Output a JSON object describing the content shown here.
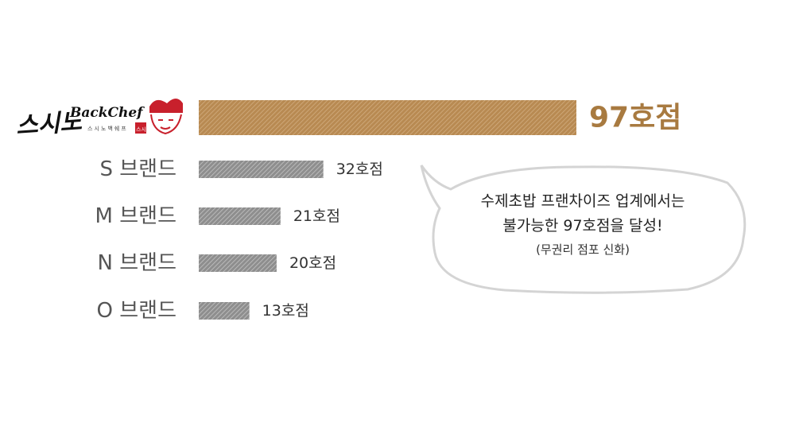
{
  "chart_data": {
    "type": "bar",
    "orientation": "horizontal",
    "categories": [
      "스시노 BackChef",
      "S 브랜드",
      "M 브랜드",
      "N 브랜드",
      "O 브랜드"
    ],
    "values": [
      97,
      32,
      21,
      20,
      13
    ],
    "value_labels": [
      "97호점",
      "32호점",
      "21호점",
      "20호점",
      "13호점"
    ],
    "highlight_index": 0,
    "colors": {
      "highlight": "#b88a52",
      "highlight_stripe": "#d2ad80",
      "other": "#8e8e8e",
      "other_stripe": "#c4c4c4",
      "highlight_label": "#a87a40",
      "label": "#333333"
    }
  },
  "logo": {
    "korean": "스시노",
    "brand": "BackChef",
    "sub": "스시노백쉐프",
    "seal": "스시"
  },
  "bubble": {
    "line1": "수제초밥 프랜차이즈 업계에서는",
    "line2": "불가능한 97호점을 달성!",
    "line3": "(무권리 점포 신화)"
  }
}
